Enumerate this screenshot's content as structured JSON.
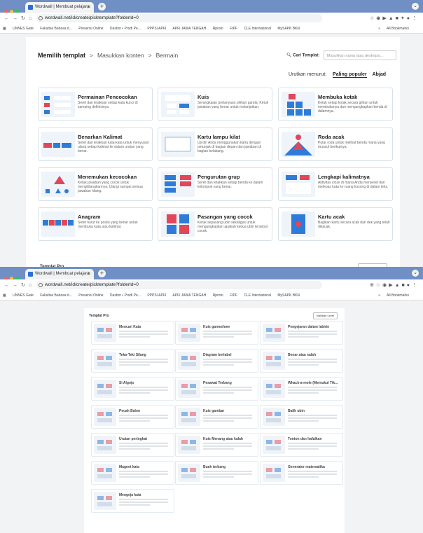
{
  "browser": {
    "tab_title": "Wordwall | Membuat pelajara",
    "url1": "wordwall.net/id/create/picktemplate?folderId=0",
    "url2": "wordwall.net/id/create/picktemplate?folderId=0",
    "bookmarks": [
      "UNNES Gate",
      "Fakultas Bahasa d...",
      "Presensi Online",
      "Dasbor • Prodi Pe...",
      "PPPSI APFI",
      "APFI JAWA TENGAH",
      "Rproto",
      "FIPF",
      "CLE International",
      "MySAPK BKN"
    ],
    "all_bookmarks": "All Bookmarks",
    "more": "»"
  },
  "breadcrumb": {
    "step1": "Memilih templat",
    "step2": "Masukkan konten",
    "step3": "Bermain",
    "separator": ">"
  },
  "search": {
    "label": "Cari Templat:",
    "placeholder": "Masukkan nama atau deskripsi..."
  },
  "sort": {
    "label": "Urutkan menurut:",
    "active": "Paling populer",
    "other": "Abjad"
  },
  "templates": [
    {
      "title": "Permainan Pencocokan",
      "desc": "Seret dan letakkan setiap kata kunci di samping definisinya."
    },
    {
      "title": "Kuis",
      "desc": "Serangkaian pertanyaan pilihan ganda. Ketuk jawaban yang benar untuk melanjutkan."
    },
    {
      "title": "Membuka kotak",
      "desc": "Ketuk setiap kotak secara giliran untuk membukanya dan mengungkapkan benda di dalamnya."
    },
    {
      "title": "Benarkan Kalimat",
      "desc": "Seret dan letakkan kata-kata untuk menyusun ulang setiap kalimat ke dalam urutan yang benar."
    },
    {
      "title": "Kartu lampu kilat",
      "desc": "Uji diri Anda menggunakan kartu dengan petunjuk di bagian depan dan jawaban di bagian belakang."
    },
    {
      "title": "Roda acak",
      "desc": "Putar roda untuk melihat benda mana yang muncul berikutnya."
    },
    {
      "title": "Menemukan kecocokan",
      "desc": "Ketuk jawaban yang cocok untuk menghilangkannya. Ulangi sampai semua jawaban hilang."
    },
    {
      "title": "Pengurutan grup",
      "desc": "Seret dan letakkan setiap benda ke dalam kelompok yang benar."
    },
    {
      "title": "Lengkapi kalimatnya",
      "desc": "Aktivitas cloze di mana Anda menyeret dan melepas kata ke ruang kosong di dalam teks."
    },
    {
      "title": "Anagram",
      "desc": "Seret huruf ke posisi yang benar untuk membuka kata atau kalimat."
    },
    {
      "title": "Pasangan yang cocok",
      "desc": "Ketuk sepasang ubin sekaligus untuk mengungkapkan apakah kedua ubin tersebut cocok."
    },
    {
      "title": "Kartu acak",
      "desc": "Bagikan kartu secara acak dari dek yang telah dikacak."
    }
  ],
  "pro": {
    "heading": "Templat Pro",
    "upgrade": "Naikkan Level",
    "items": [
      "Mencari Kata",
      "Kuis gameshow",
      "Pengejaran dalam labirin",
      "Teka-Teki Silang",
      "Diagram berlabel",
      "Benar atau salah",
      "Si Algojo",
      "Pesawat Terbang",
      "Whack-a-mole (Memukul Tik...",
      "Pecah Balon",
      "Kuis gambar",
      "Balik ubin",
      "Urutan peringkat",
      "Kuis Menang atau kalah",
      "Tonton dan hafalkan",
      "Magnet kata",
      "Buah terbang",
      "Generator matematika",
      "Mengeja kata"
    ]
  },
  "colors": {
    "accent": "#2a6fd6",
    "red": "#e0475b",
    "dark": "#222222"
  }
}
